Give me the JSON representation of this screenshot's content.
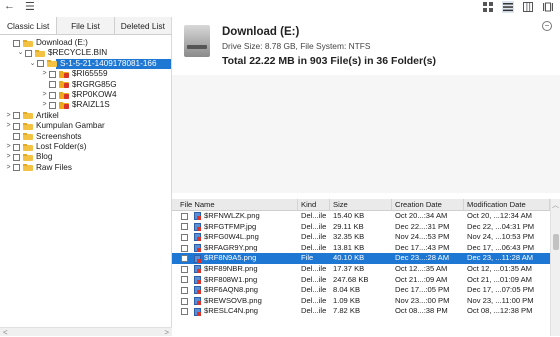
{
  "toolbar": {
    "back_icon": "back-arrow-icon",
    "menu_icon": "hamburger-menu-icon",
    "views": [
      "grid-view-icon",
      "list-view-icon",
      "columns-view-icon",
      "detail-view-icon"
    ]
  },
  "tabs": [
    "Classic List",
    "File List",
    "Deleted List"
  ],
  "tree": [
    {
      "label": "Download (E:)",
      "indent": 0,
      "exp": "",
      "type": "folder"
    },
    {
      "label": "$RECYCLE.BIN",
      "indent": 1,
      "exp": "⌄",
      "type": "folder"
    },
    {
      "label": "S-1-5-21-1409178081-166",
      "indent": 2,
      "exp": "⌄",
      "type": "folder",
      "selected": true
    },
    {
      "label": "$RI65559",
      "indent": 3,
      "exp": ">",
      "type": "deleted"
    },
    {
      "label": "$RGRG85G",
      "indent": 3,
      "exp": "",
      "type": "deleted"
    },
    {
      "label": "$RP0KOW4",
      "indent": 3,
      "exp": ">",
      "type": "deleted"
    },
    {
      "label": "$RAIZL1S",
      "indent": 3,
      "exp": ">",
      "type": "deleted"
    },
    {
      "label": "Artikel",
      "indent": 0,
      "exp": ">",
      "type": "folder"
    },
    {
      "label": "Kumpulan Gambar",
      "indent": 0,
      "exp": ">",
      "type": "folder"
    },
    {
      "label": "Screenshots",
      "indent": 0,
      "exp": "",
      "type": "folder"
    },
    {
      "label": "Lost Folder(s)",
      "indent": 0,
      "exp": ">",
      "type": "folder"
    },
    {
      "label": "Blog",
      "indent": 0,
      "exp": ">",
      "type": "folder"
    },
    {
      "label": "Raw Files",
      "indent": 0,
      "exp": ">",
      "type": "folder"
    }
  ],
  "drive": {
    "name": "Download (E:)",
    "info": "Drive Size: 8.78 GB, File System: NTFS",
    "total": "Total 22.22 MB in 903 File(s) in 36 Folder(s)"
  },
  "columns": [
    "File Name",
    "Kind",
    "Size",
    "Creation Date",
    "Modification Date"
  ],
  "files": [
    {
      "name": "$RFNWLZK.png",
      "kind": "Del...ile",
      "size": "15.40 KB",
      "cdate": "Oct 20...:34 AM",
      "mdate": "Oct 20, ...12:34 AM"
    },
    {
      "name": "$RFGTFMP.jpg",
      "kind": "Del...ile",
      "size": "29.11 KB",
      "cdate": "Dec 22...:31 PM",
      "mdate": "Dec 22, ...04:31 PM"
    },
    {
      "name": "$RFG0W4L.png",
      "kind": "Del...ile",
      "size": "32.35 KB",
      "cdate": "Nov 24...:53 PM",
      "mdate": "Nov 24, ...10:53 PM"
    },
    {
      "name": "$RFAGR9Y.png",
      "kind": "Del...ile",
      "size": "13.81 KB",
      "cdate": "Dec 17...:43 PM",
      "mdate": "Dec 17, ...06:43 PM"
    },
    {
      "name": "$RF8N9A5.png",
      "kind": "File",
      "size": "40.10 KB",
      "cdate": "Dec 23...:28 AM",
      "mdate": "Dec 23, ...11:28 AM",
      "selected": true
    },
    {
      "name": "$RF89NBR.png",
      "kind": "Del...ile",
      "size": "17.37 KB",
      "cdate": "Oct 12...:35 AM",
      "mdate": "Oct 12, ...01:35 AM"
    },
    {
      "name": "$RF808W1.png",
      "kind": "Del...ile",
      "size": "247.68 KB",
      "cdate": "Oct 21...:09 AM",
      "mdate": "Oct 21, ...01:09 AM"
    },
    {
      "name": "$RF6AQN8.png",
      "kind": "Del...ile",
      "size": "8.04 KB",
      "cdate": "Dec 17...:05 PM",
      "mdate": "Dec 17, ...07:05 PM"
    },
    {
      "name": "$REWSOVB.png",
      "kind": "Del...ile",
      "size": "1.09 KB",
      "cdate": "Nov 23...:00 PM",
      "mdate": "Nov 23, ...11:00 PM"
    },
    {
      "name": "$RESLC4N.png",
      "kind": "Del...ile",
      "size": "7.82 KB",
      "cdate": "Oct 08...:38 PM",
      "mdate": "Oct 08, ...12:38 PM"
    }
  ]
}
